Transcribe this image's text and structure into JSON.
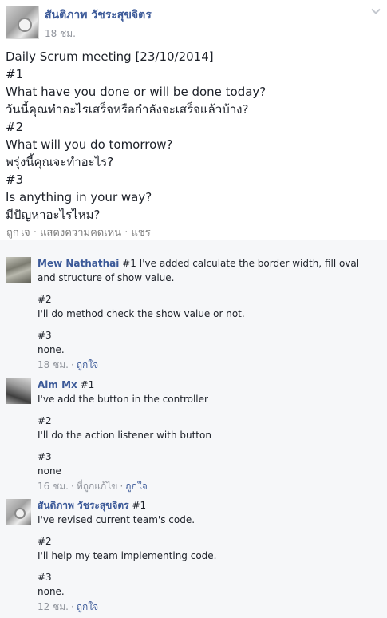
{
  "post": {
    "author": "สันติภาพ วัชระสุขจิตร",
    "time": "18 ชม.",
    "body_lines": [
      "Daily Scrum meeting [23/10/2014]",
      "#1",
      "What have you done or will be done today?",
      "วันนี้คุณทำอะไรเสร็จหรือกำลังจะเสร็จแล้วบ้าง?",
      "#2",
      "What will you do tomorrow?",
      "พรุ่งนี้คุณจะทำอะไร?",
      "#3",
      "Is anything in your way?",
      "มีปัญหาอะไรไหม?"
    ],
    "cut_text": "ถูกใจ · แสดงความคิดเห็น · แชร์"
  },
  "comments": [
    {
      "author": "Mew Nathathai",
      "first_line_rest": " #1 I've added calculate the border width, fill oval",
      "lines": [
        "and structure of show value.",
        "",
        "#2",
        "I'll do method check the show value or not.",
        "",
        "#3",
        "none."
      ],
      "time": "18 ชม.",
      "edited": "",
      "like": "ถูกใจ"
    },
    {
      "author": "Aim Mx",
      "first_line_rest": " #1",
      "lines": [
        "I've add the button in the controller",
        "",
        "#2",
        "I'll do the action listener with button",
        "",
        "#3",
        "none"
      ],
      "time": "16 ชม.",
      "edited": "ที่ถูกแก้ไข",
      "like": "ถูกใจ"
    },
    {
      "author": "สันติภาพ วัชระสุขจิตร",
      "first_line_rest": " #1",
      "lines": [
        "I've revised current team's code.",
        "",
        "#2",
        "I'll help my team implementing code.",
        "",
        "#3",
        "none."
      ],
      "time": "12 ชม.",
      "edited": "",
      "like": "ถูกใจ"
    }
  ],
  "colors": {
    "link_blue": "#3b5998",
    "meta_gray": "#90949c",
    "comments_bg": "#f6f7f9"
  },
  "icons": {
    "options": "chevron-down-icon"
  }
}
